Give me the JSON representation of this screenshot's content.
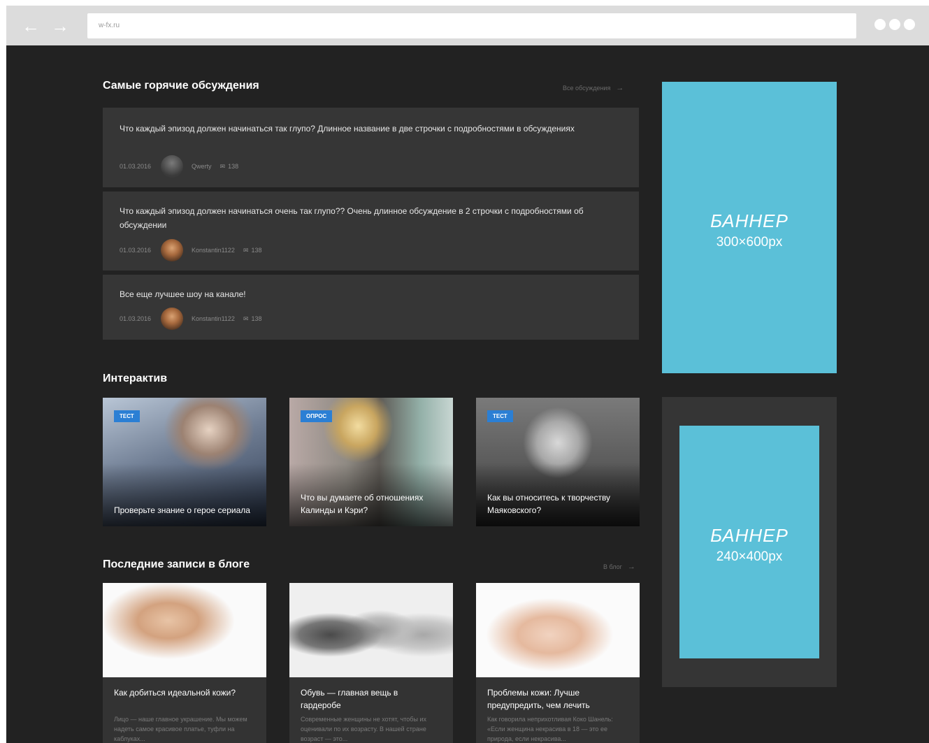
{
  "browser": {
    "back_label": "←",
    "forward_label": "→",
    "address": "w-fx.ru"
  },
  "discussions": {
    "title": "Самые горячие обсуждения",
    "all_link": "Все обсуждения",
    "items": [
      {
        "title": "Что каждый эпизод должен начинаться так глупо? Длинное название в две строчки с подробностями в обсуждениях",
        "date": "01.03.2016",
        "author": "Qwerty",
        "views": "138"
      },
      {
        "title": "Что каждый эпизод должен начинаться очень так глупо?? Очень длинное обсуждение в 2 строчки с подробностями об обсуждении",
        "date": "01.03.2016",
        "author": "Konstantin1122",
        "views": "138"
      },
      {
        "title": "Все еще лучшее шоу на канале!",
        "date": "01.03.2016",
        "author": "Konstantin1122",
        "views": "138"
      }
    ]
  },
  "interactive": {
    "title": "Интерактив",
    "items": [
      {
        "badge": "Тест",
        "caption": "Проверьте знание о герое сериала"
      },
      {
        "badge": "Опрос",
        "caption": "Что вы думаете об отношениях Калинды и Кэри?"
      },
      {
        "badge": "Тест",
        "caption": "Как вы относитесь к творчеству Маяковского?"
      }
    ]
  },
  "blog": {
    "title": "Последние записи в блоге",
    "all_link": "В блог",
    "items": [
      {
        "title": "Как добиться идеальной кожи?",
        "excerpt": "Лицо — наше главное украшение. Мы можем надеть самое красивое платье, туфли на каблуках..."
      },
      {
        "title": "Обувь — главная вещь в гардеробе",
        "excerpt": "Современные женщины не хотят, чтобы их оценивали по их возрасту. В нашей стране возраст — это..."
      },
      {
        "title": "Проблемы кожи: Лучше предупредить, чем лечить",
        "excerpt": "Как говорила неприхотливая Коко Шанель: «Если женщина некрасива в 18 — это ее природа, если некрасива..."
      }
    ]
  },
  "banners": {
    "big": {
      "label": "БАННЕР",
      "size": "300×600px"
    },
    "small": {
      "label": "БАННЕР",
      "size": "240×400px"
    }
  }
}
